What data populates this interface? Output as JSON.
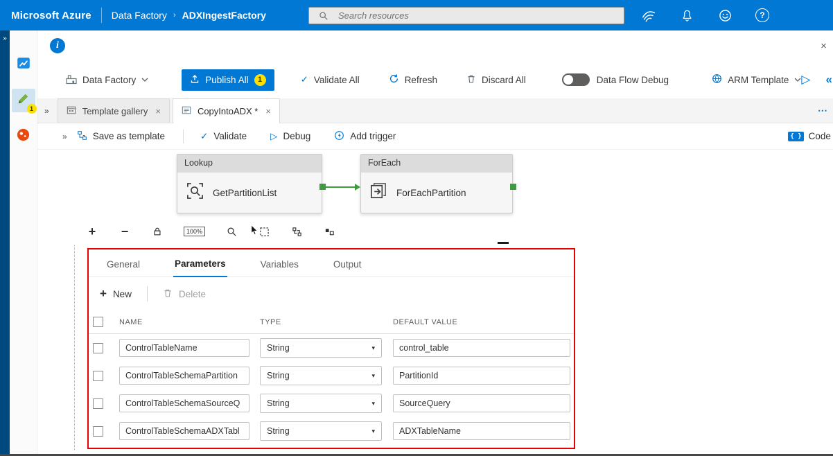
{
  "icons": {
    "chevrons_right": "»",
    "chevrons_left": "«",
    "ellipsis": "⋯",
    "plus": "+",
    "minus": "−",
    "play": "▷",
    "check": "✓",
    "caret_down": "▾",
    "close": "×",
    "breadcrumb_sep": "›",
    "info": "i",
    "question": "?"
  },
  "topbar": {
    "brand": "Microsoft Azure",
    "breadcrumb": {
      "app": "Data Factory",
      "item": "ADXIngestFactory"
    },
    "search": {
      "placeholder": "Search resources"
    }
  },
  "sidebar": {
    "author_badge": "1"
  },
  "toolbar": {
    "factory_selector": "Data Factory",
    "publish_all": "Publish All",
    "publish_badge": "1",
    "validate_all": "Validate All",
    "refresh": "Refresh",
    "discard_all": "Discard All",
    "data_flow_debug": "Data Flow Debug",
    "arm_template": "ARM Template"
  },
  "tabrow": {
    "tabs": [
      {
        "label": "Template gallery"
      },
      {
        "label": "CopyIntoADX *"
      }
    ]
  },
  "pipebar": {
    "save_as_template": "Save as template",
    "validate": "Validate",
    "debug": "Debug",
    "add_trigger": "Add trigger",
    "code": "Code"
  },
  "canvas": {
    "zoom_level": "100%",
    "activities": [
      {
        "type": "Lookup",
        "name": "GetPartitionList"
      },
      {
        "type": "ForEach",
        "name": "ForEachPartition"
      }
    ]
  },
  "panel": {
    "tabs": [
      "General",
      "Parameters",
      "Variables",
      "Output"
    ],
    "active_tab": "Parameters",
    "commands": {
      "new": "New",
      "delete": "Delete"
    },
    "columns": [
      "NAME",
      "TYPE",
      "DEFAULT VALUE"
    ],
    "rows": [
      {
        "name": "ControlTableName",
        "type": "String",
        "default_value": "control_table"
      },
      {
        "name": "ControlTableSchemaPartition",
        "type": "String",
        "default_value": "PartitionId"
      },
      {
        "name": "ControlTableSchemaSourceQ",
        "type": "String",
        "default_value": "SourceQuery"
      },
      {
        "name": "ControlTableSchemaADXTabl",
        "type": "String",
        "default_value": "ADXTableName"
      }
    ]
  },
  "colors": {
    "azure_blue": "#0078d4",
    "annotation_red": "#e60000",
    "connector_green": "#3d9c3d",
    "badge_yellow": "#fce100"
  }
}
